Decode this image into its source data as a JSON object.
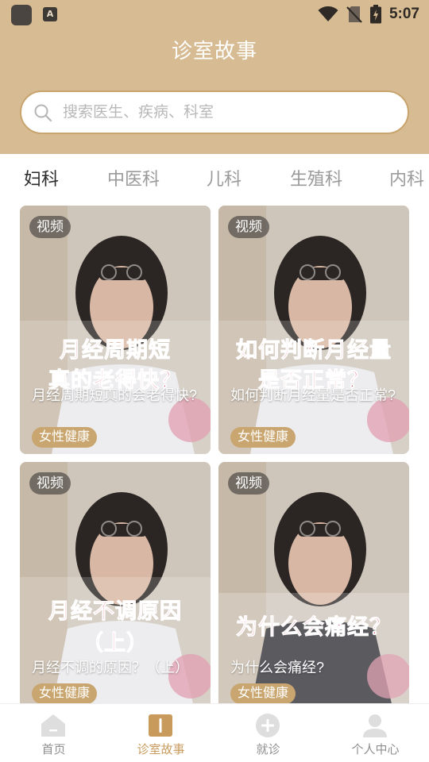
{
  "status_bar": {
    "time": "5:07",
    "icons": [
      "app-icon",
      "a-notification-icon",
      "wifi-icon",
      "no-sim-icon",
      "battery-charging-icon"
    ]
  },
  "header": {
    "title": "诊室故事",
    "background_color": "#D6BB93"
  },
  "search": {
    "placeholder": "搜索医生、疾病、科室",
    "value": "",
    "border_color": "#C8A46E"
  },
  "tabs": [
    {
      "label": "妇科",
      "active": true
    },
    {
      "label": "中医科",
      "active": false
    },
    {
      "label": "儿科",
      "active": false
    },
    {
      "label": "生殖科",
      "active": false
    },
    {
      "label": "内科",
      "active": false
    }
  ],
  "cards": [
    {
      "badge": "视频",
      "cover_lines": [
        "月经周期短",
        "真的老得快？"
      ],
      "title": "月经周期短真的会老得快?",
      "tag": "女性健康"
    },
    {
      "badge": "视频",
      "cover_lines": [
        "如何判断月经量",
        "是否正常？"
      ],
      "title": "如何判断月经量是否正常?",
      "tag": "女性健康"
    },
    {
      "badge": "视频",
      "cover_lines": [
        "月经不调原因",
        "（上）"
      ],
      "title": "月经不调的原因？（上）",
      "tag": "女性健康"
    },
    {
      "badge": "视频",
      "cover_lines": [
        "为什么会痛经？"
      ],
      "title": "为什么会痛经?",
      "tag": "女性健康"
    }
  ],
  "bottom_nav": [
    {
      "label": "首页",
      "icon": "home-icon",
      "active": false
    },
    {
      "label": "诊室故事",
      "icon": "book-icon",
      "active": true
    },
    {
      "label": "就诊",
      "icon": "plus-circle-icon",
      "active": false
    },
    {
      "label": "个人中心",
      "icon": "person-icon",
      "active": false
    }
  ],
  "colors": {
    "accent": "#C89B5C",
    "tag_bg": "#C9A56F",
    "cover_text": "#E0546F"
  }
}
